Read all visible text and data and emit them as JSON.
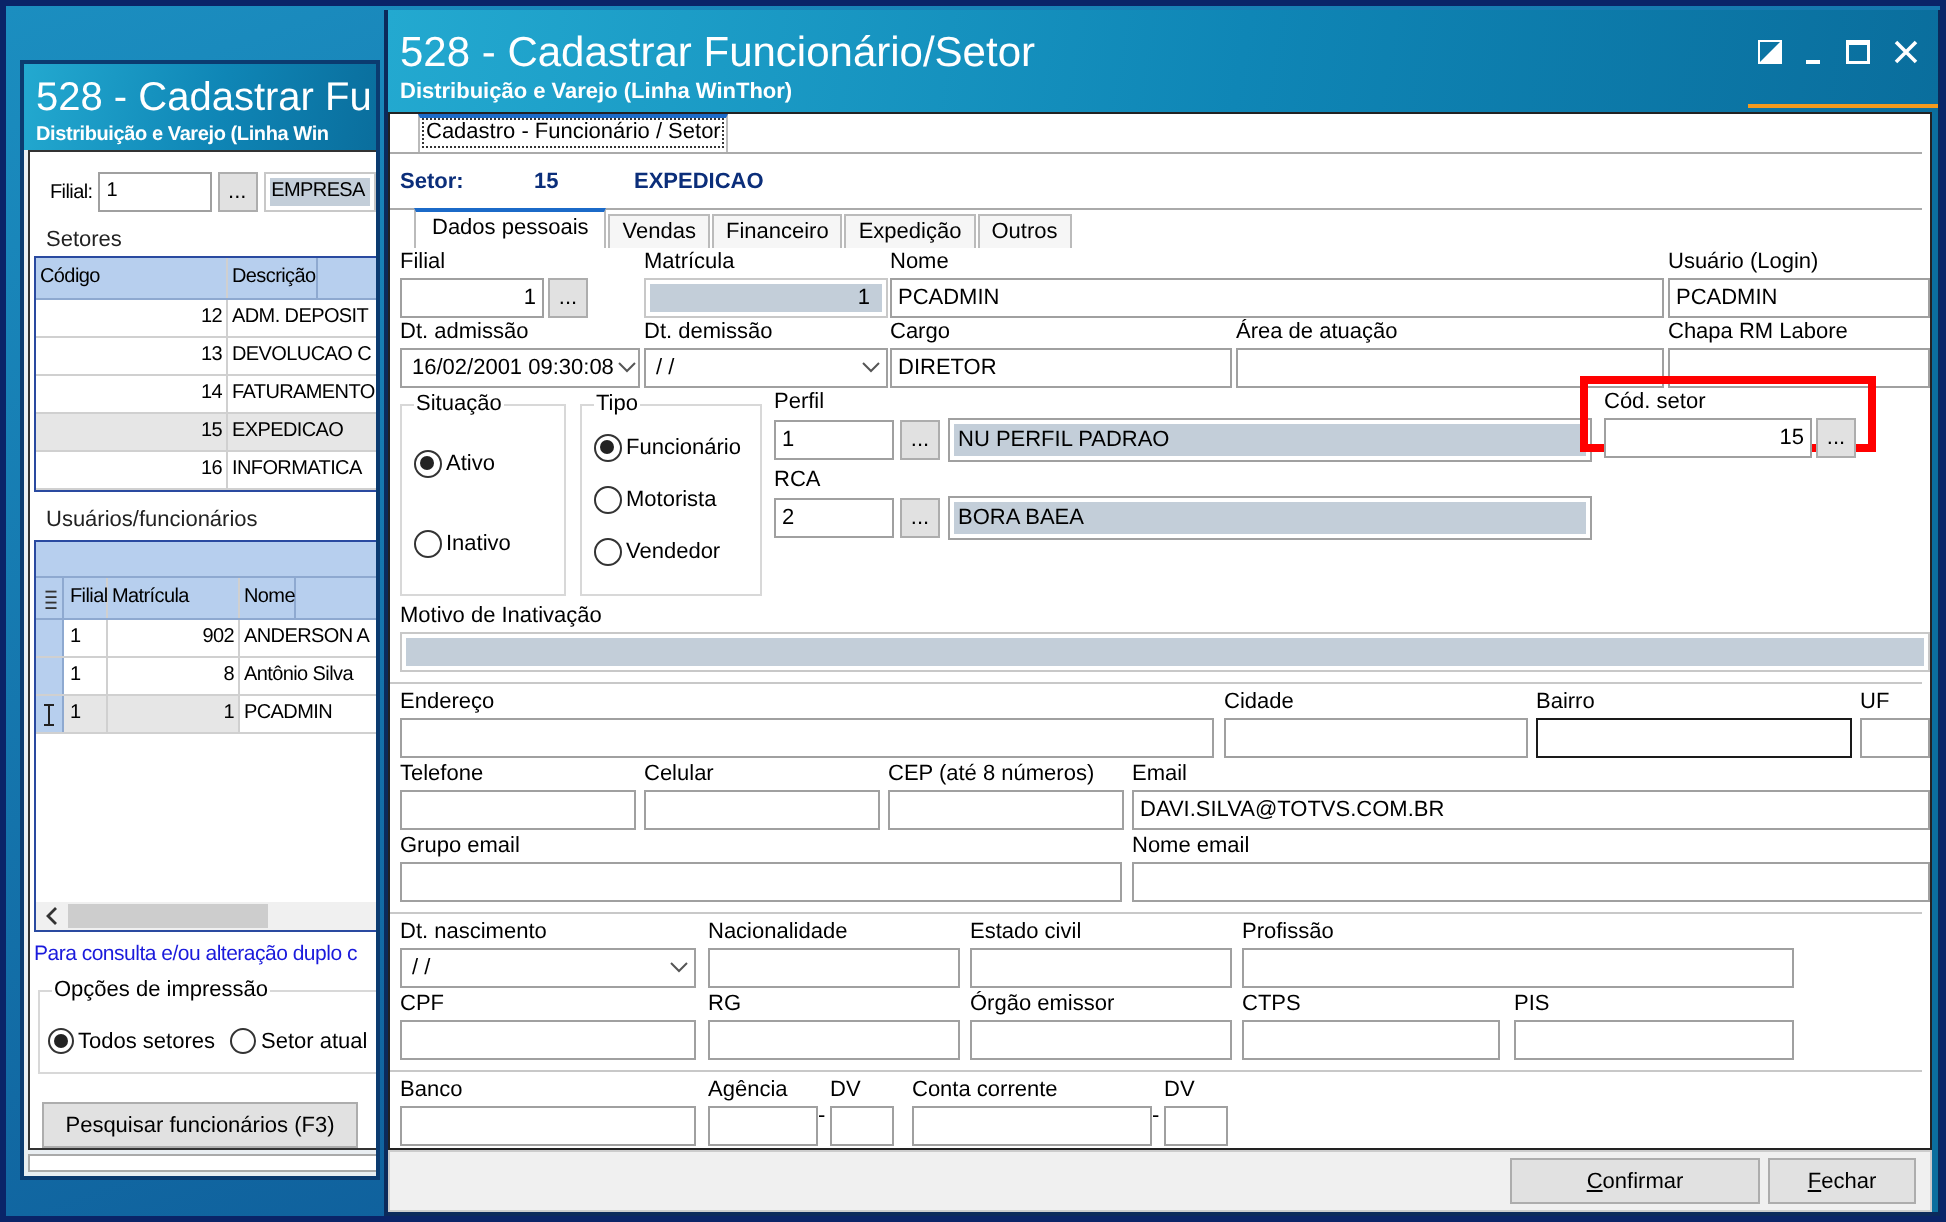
{
  "back_window": {
    "title": "528 - Cadastrar Fu",
    "subtitle": "Distribuição e Varejo (Linha Win",
    "filial": {
      "label": "Filial:",
      "value": "1",
      "button": "...",
      "name": "EMPRESA"
    },
    "setores": {
      "title": "Setores",
      "columns": [
        "Código",
        "Descrição"
      ],
      "rows": [
        {
          "cells": [
            "12",
            "ADM. DEPOSIT"
          ],
          "selected": false
        },
        {
          "cells": [
            "13",
            "DEVOLUCAO C"
          ],
          "selected": false
        },
        {
          "cells": [
            "14",
            "FATURAMENTO"
          ],
          "selected": false
        },
        {
          "cells": [
            "15",
            "EXPEDICAO"
          ],
          "selected": true
        },
        {
          "cells": [
            "16",
            "INFORMATICA"
          ],
          "selected": false
        }
      ]
    },
    "usuarios": {
      "title": "Usuários/funcionários",
      "columns": [
        "Filial",
        "Matrícula",
        "Nome"
      ],
      "rows": [
        {
          "cells": [
            "1",
            "902",
            "ANDERSON A"
          ],
          "current": false
        },
        {
          "cells": [
            "1",
            "8",
            "Antônio Silva"
          ],
          "current": false
        },
        {
          "cells": [
            "1",
            "1",
            "PCADMIN"
          ],
          "current": true
        }
      ]
    },
    "hint": "Para consulta e/ou alteração duplo c",
    "print_options": {
      "title": "Opções de impressão",
      "options": [
        {
          "label": "Todos setores",
          "selected": true
        },
        {
          "label": "Setor atual",
          "selected": false
        }
      ]
    },
    "search_button": "Pesquisar funcionários (F3)"
  },
  "window": {
    "title": "528 - Cadastrar Funcionário/Setor",
    "subtitle": "Distribuição e Varejo (Linha WinThor)"
  },
  "outer_tab": {
    "label": "Cadastro - Funcionário / Setor",
    "selected": true
  },
  "setor": {
    "label": "Setor:",
    "code": "15",
    "name": "EXPEDICAO"
  },
  "tabs": [
    {
      "label": "Dados pessoais",
      "selected": true
    },
    {
      "label": "Vendas",
      "selected": false
    },
    {
      "label": "Financeiro",
      "selected": false
    },
    {
      "label": "Expedição",
      "selected": false
    },
    {
      "label": "Outros",
      "selected": false
    }
  ],
  "top_rows": [
    [
      {
        "label": "Filial",
        "value": "1",
        "kind": "text",
        "button": "...",
        "focused": false
      },
      {
        "label": "Matrícula",
        "value": "1",
        "kind": "readonly",
        "focused": false
      },
      {
        "label": "Nome",
        "value": "PCADMIN",
        "kind": "text",
        "focused": false
      },
      {
        "label": "Usuário (Login)",
        "value": "PCADMIN",
        "kind": "text",
        "focused": false
      }
    ],
    [
      {
        "label": "Dt. admissão",
        "value": "16/02/2001 09:30:08",
        "kind": "date",
        "focused": false
      },
      {
        "label": "Dt.  demissão",
        "value": "/ /",
        "kind": "date",
        "focused": false
      },
      {
        "label": "Cargo",
        "value": "DIRETOR",
        "kind": "text",
        "focused": false
      },
      {
        "label": "Área de atuação",
        "kind": "text",
        "focused": false
      },
      {
        "label": "Chapa RM Labore",
        "kind": "text",
        "focused": false
      }
    ]
  ],
  "situacao": {
    "title": "Situação",
    "options": [
      {
        "label": "Ativo",
        "selected": true
      },
      {
        "label": "Inativo",
        "selected": false
      }
    ]
  },
  "tipo": {
    "title": "Tipo",
    "options": [
      {
        "label": "Funcionário",
        "selected": true
      },
      {
        "label": "Motorista",
        "selected": false
      },
      {
        "label": "Vendedor",
        "selected": false
      }
    ]
  },
  "perfil": {
    "label": "Perfil",
    "value": "1",
    "button": "...",
    "description": "NU  PERFIL PADRAO"
  },
  "rca": {
    "label": "RCA",
    "value": "2",
    "button": "...",
    "description": "BORA BAEA"
  },
  "cod_setor": {
    "label": "Cód. setor",
    "value": "15",
    "button": "...",
    "highlighted": true
  },
  "sections": [
    [
      [
        {
          "label": "Motivo de Inativação",
          "kind": "readonly",
          "focused": false
        }
      ]
    ],
    [
      [
        {
          "label": "Endereço",
          "kind": "text",
          "focused": false
        },
        {
          "label": "Cidade",
          "kind": "text",
          "focused": false
        },
        {
          "label": "Bairro",
          "kind": "text",
          "focused": true
        },
        {
          "label": "UF",
          "kind": "text",
          "focused": false
        }
      ],
      [
        {
          "label": "Telefone",
          "kind": "text",
          "focused": false
        },
        {
          "label": "Celular",
          "kind": "text",
          "focused": false
        },
        {
          "label": "CEP (até 8 números)",
          "kind": "text",
          "focused": false
        },
        {
          "label": "Email",
          "value": "DAVI.SILVA@TOTVS.COM.BR",
          "kind": "text",
          "focused": false
        }
      ],
      [
        {
          "label": "Grupo email",
          "kind": "text",
          "focused": false
        },
        {
          "label": "Nome email",
          "kind": "text",
          "focused": false
        }
      ]
    ],
    [
      [
        {
          "label": "Dt. nascimento",
          "value": "/ /",
          "kind": "date",
          "focused": false
        },
        {
          "label": "Nacionalidade",
          "kind": "text",
          "focused": false
        },
        {
          "label": "Estado civil",
          "kind": "text",
          "focused": false
        },
        {
          "label": "Profissão",
          "kind": "text",
          "focused": false
        }
      ],
      [
        {
          "label": "CPF",
          "kind": "text",
          "focused": false
        },
        {
          "label": "RG",
          "kind": "text",
          "focused": false
        },
        {
          "label": "Órgão emissor",
          "kind": "text",
          "focused": false
        },
        {
          "label": "CTPS",
          "kind": "text",
          "focused": false
        },
        {
          "label": "PIS",
          "kind": "text",
          "focused": false
        }
      ]
    ],
    [
      [
        {
          "label": "Banco",
          "kind": "text",
          "focused": false
        },
        {
          "label": "Agência",
          "kind": "text",
          "focused": false
        },
        {
          "label": "DV",
          "prefix": "-",
          "kind": "text",
          "focused": false
        },
        {
          "label": "Conta corrente",
          "kind": "text",
          "focused": false
        },
        {
          "label": "DV",
          "prefix": "-",
          "kind": "text",
          "focused": false
        }
      ]
    ]
  ],
  "buttons": [
    {
      "label": "Confirmar"
    },
    {
      "label": "Fechar"
    }
  ]
}
